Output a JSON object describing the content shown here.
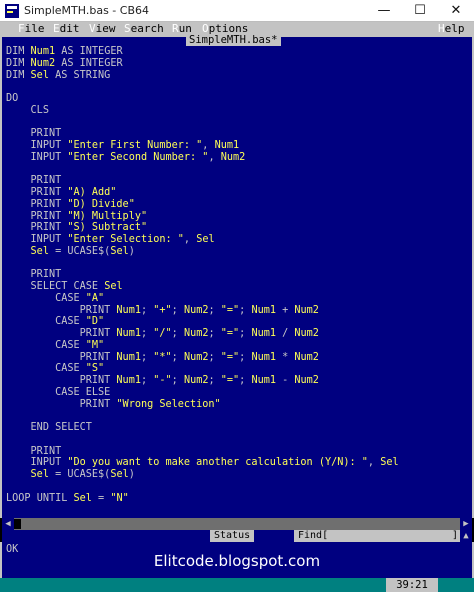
{
  "window": {
    "title": "SimpleMTH.bas - CB64"
  },
  "menu": {
    "items": [
      "File",
      "Edit",
      "View",
      "Search",
      "Run",
      "Options"
    ],
    "help": "Help"
  },
  "editor": {
    "file_tab": "SimpleMTH.bas*",
    "lines": [
      "DIM Num1 AS INTEGER",
      "DIM Num2 AS INTEGER",
      "DIM Sel AS STRING",
      "",
      "DO",
      "    CLS",
      "",
      "    PRINT",
      "    INPUT \"Enter First Number: \", Num1",
      "    INPUT \"Enter Second Number: \", Num2",
      "",
      "    PRINT",
      "    PRINT \"A) Add\"",
      "    PRINT \"D) Divide\"",
      "    PRINT \"M) Multiply\"",
      "    PRINT \"S) Subtract\"",
      "    INPUT \"Enter Selection: \", Sel",
      "    Sel = UCASE$(Sel)",
      "",
      "    PRINT",
      "    SELECT CASE Sel",
      "        CASE \"A\"",
      "            PRINT Num1; \"+\"; Num2; \"=\"; Num1 + Num2",
      "        CASE \"D\"",
      "            PRINT Num1; \"/\"; Num2; \"=\"; Num1 / Num2",
      "        CASE \"M\"",
      "            PRINT Num1; \"*\"; Num2; \"=\"; Num1 * Num2",
      "        CASE \"S\"",
      "            PRINT Num1; \"-\"; Num2; \"=\"; Num1 - Num2",
      "        CASE ELSE",
      "            PRINT \"Wrong Selection\"",
      "",
      "    END SELECT",
      "",
      "    PRINT",
      "    INPUT \"Do you want to make another calculation (Y/N): \", Sel",
      "    Sel = UCASE$(Sel)",
      "",
      "LOOP UNTIL Sel = \"N\""
    ]
  },
  "status": {
    "title": "Status",
    "find_label": "Find[",
    "find_close": "]",
    "message": "OK"
  },
  "watermark": "Elitcode.blogspot.com",
  "cursor_position": "39:21",
  "colors": {
    "editor_bg": "#000080",
    "chrome": "#c3c3c3",
    "bottom_bar": "#008080",
    "highlight": "#ffff55"
  }
}
